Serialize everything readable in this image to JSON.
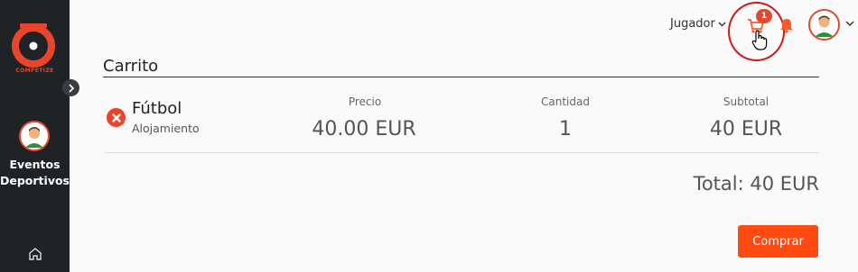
{
  "brand": {
    "logo_text": "COMPETIZE",
    "color": "#e8452c"
  },
  "sidebar": {
    "section_label": "Eventos Deportivos",
    "collapse_icon": "chevron-right-icon",
    "home_icon": "home-icon"
  },
  "header": {
    "role_label": "Jugador",
    "cart_count": "1"
  },
  "cart": {
    "title": "Carrito",
    "columns": {
      "price": "Precio",
      "quantity": "Cantidad",
      "subtotal": "Subtotal"
    },
    "items": [
      {
        "name": "Fútbol",
        "subtitle": "Alojamiento",
        "price": "40.00 EUR",
        "quantity": "1",
        "subtotal": "40 EUR"
      }
    ],
    "total": "Total: 40 EUR",
    "buy_label": "Comprar"
  },
  "colors": {
    "accent": "#ff4a12",
    "sidebar_bg": "#1f2326",
    "annotation": "#d21a1a"
  }
}
